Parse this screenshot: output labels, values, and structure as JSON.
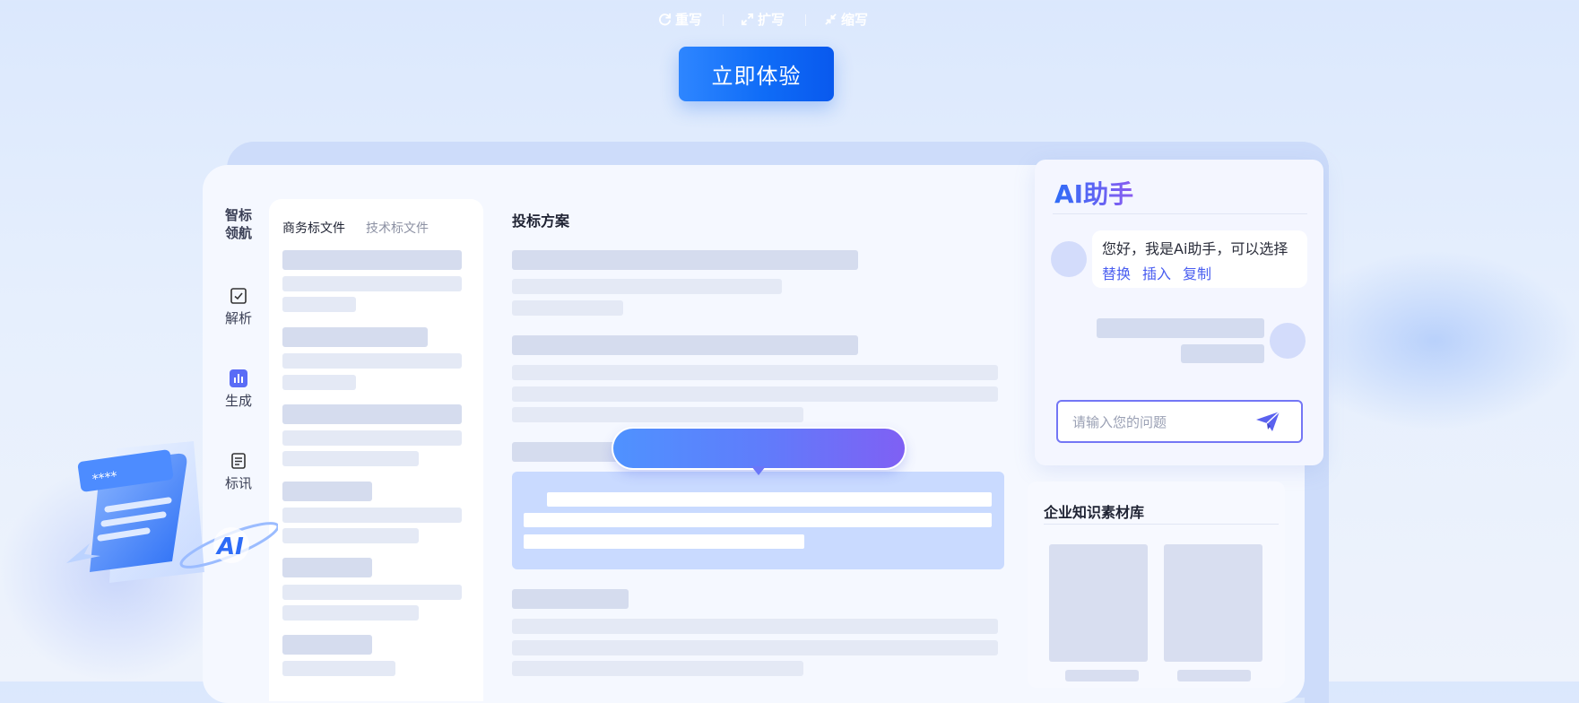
{
  "cta": {
    "label": "立即体验"
  },
  "nav": {
    "logo": "智标领航",
    "items": [
      {
        "label": "解析",
        "icon": "checkbox-icon"
      },
      {
        "label": "生成",
        "icon": "bar-chart-icon"
      },
      {
        "label": "标讯",
        "icon": "document-icon"
      }
    ]
  },
  "left_panel": {
    "tabs": [
      "商务标文件",
      "技术标文件"
    ],
    "active_tab": 0
  },
  "main": {
    "title": "投标方案"
  },
  "popover": {
    "buttons": [
      "重写",
      "扩写",
      "缩写"
    ],
    "icons": [
      "refresh-icon",
      "expand-icon",
      "shrink-icon"
    ]
  },
  "ai_assistant": {
    "title": "AI助手",
    "message": "您好，我是Ai助手，可以选择",
    "actions": [
      "替换",
      "插入",
      "复制"
    ],
    "input_placeholder": "请输入您的问题",
    "send_icon": "send-icon"
  },
  "knowledge": {
    "title": "企业知识素材库"
  },
  "illustration": {
    "badge_text": "AI",
    "stars": "****"
  },
  "colors": {
    "accent": "#1672fa",
    "ai_gradient_start": "#2e6cf7",
    "ai_gradient_end": "#8a5cf0",
    "input_border": "#7376f5"
  }
}
